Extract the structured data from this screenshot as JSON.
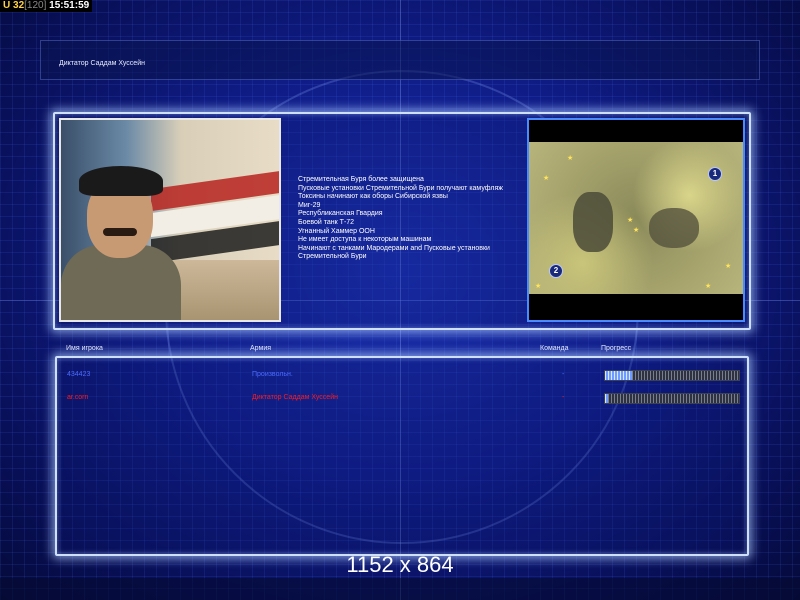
{
  "status": {
    "u_label": "U",
    "units": "32",
    "cap": "[120]",
    "time": "15:51:59"
  },
  "title": "Диктатор Саддам Хуссейн",
  "description": [
    "Стремительная Буря более защищена",
    "Пусковые установки Стремительной Бури получают камуфляж",
    "Токсины начинают как оборы Сибирской язвы",
    "Миг-29",
    "Республиканская Гвардия",
    "Боевой танк Т-72",
    "Угнанный Хаммер ООН",
    "Не имеет доступа к некоторым машинам",
    "Начинают с танками Мародерами and Пусковые установки",
    " Стремительной Бури"
  ],
  "minimap": {
    "marker1": "1",
    "marker2": "2"
  },
  "headers": {
    "player": "Имя игрока",
    "army": "Армия",
    "team": "Команда",
    "progress": "Прогресс"
  },
  "players": [
    {
      "name": "434423",
      "army": "Произвольн.",
      "team": "-",
      "progress": 0.2,
      "color": "#4b6bff"
    },
    {
      "name": "ar.corn",
      "army": "Диктатор Саддам Хуссейн",
      "team": "-",
      "progress": 0.02,
      "color": "#ff1a1a"
    }
  ],
  "resolution": "1152 x 864"
}
